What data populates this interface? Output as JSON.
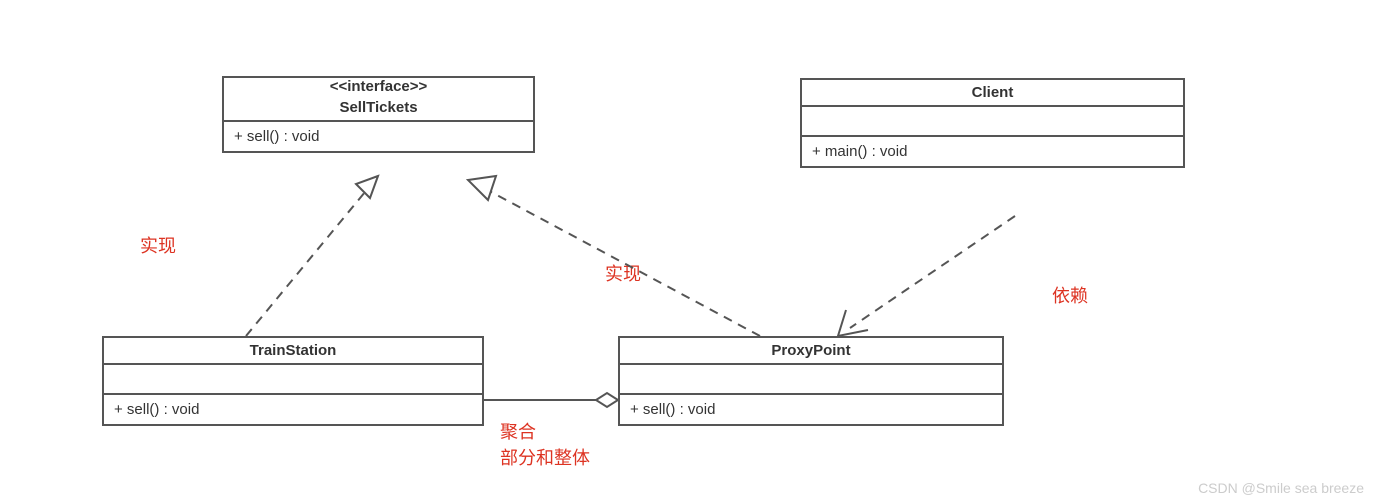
{
  "interface": {
    "stereotype": "<<interface>>",
    "name": "SellTickets",
    "method": "+ sell() : void"
  },
  "client": {
    "name": "Client",
    "method": "+ main() : void"
  },
  "trainStation": {
    "name": "TrainStation",
    "method": "+ sell() : void"
  },
  "proxyPoint": {
    "name": "ProxyPoint",
    "method": "+ sell() : void"
  },
  "labels": {
    "realize1": "实现",
    "realize2": "实现",
    "dependency": "依赖",
    "aggregationLine1": "聚合",
    "aggregationLine2": "部分和整体"
  },
  "watermark": "CSDN @Smile sea breeze",
  "chart_data": {
    "type": "uml_class_diagram",
    "classes": [
      {
        "name": "SellTickets",
        "stereotype": "interface",
        "methods": [
          "+ sell() : void"
        ]
      },
      {
        "name": "Client",
        "methods": [
          "+ main() : void"
        ]
      },
      {
        "name": "TrainStation",
        "methods": [
          "+ sell() : void"
        ]
      },
      {
        "name": "ProxyPoint",
        "methods": [
          "+ sell() : void"
        ]
      }
    ],
    "relationships": [
      {
        "from": "TrainStation",
        "to": "SellTickets",
        "type": "realization",
        "label": "实现"
      },
      {
        "from": "ProxyPoint",
        "to": "SellTickets",
        "type": "realization",
        "label": "实现"
      },
      {
        "from": "Client",
        "to": "ProxyPoint",
        "type": "dependency",
        "label": "依赖"
      },
      {
        "from": "ProxyPoint",
        "to": "TrainStation",
        "type": "aggregation",
        "label": "聚合 部分和整体"
      }
    ]
  }
}
